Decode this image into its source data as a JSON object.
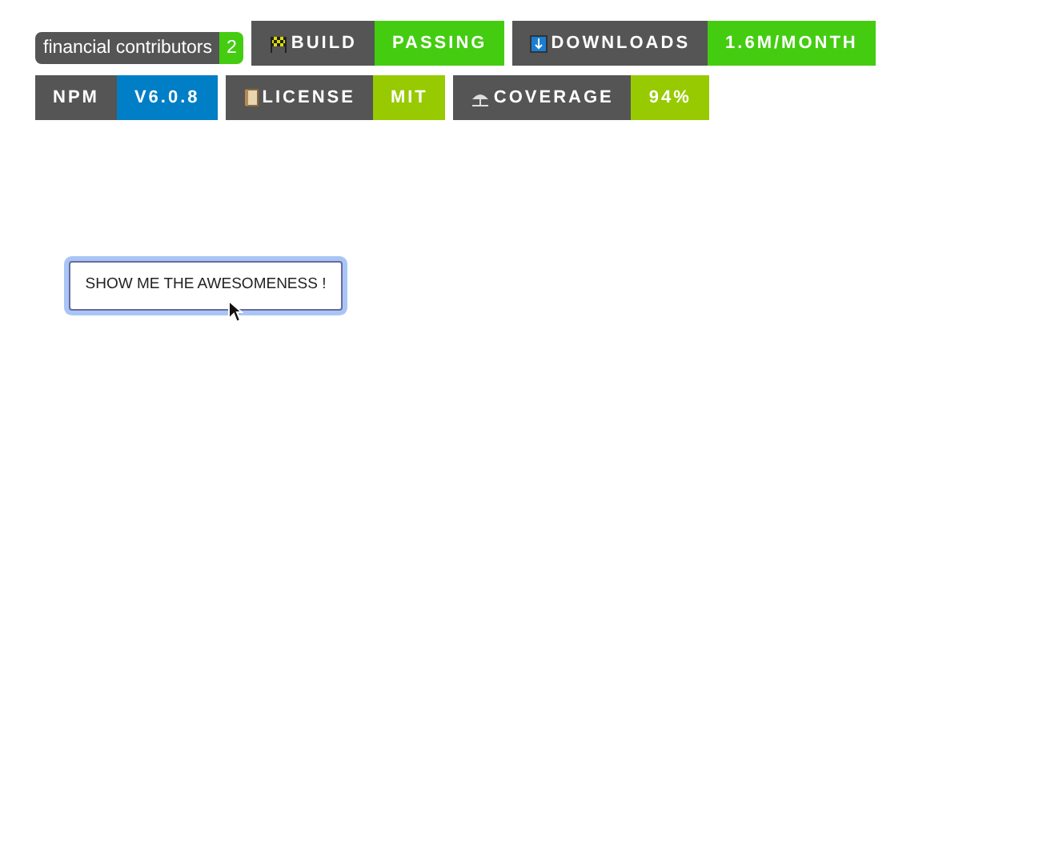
{
  "badges": [
    {
      "kind": "rounded",
      "label": "financial contributors",
      "value": "2",
      "color": "#4c1"
    },
    {
      "kind": "square",
      "label": "BUILD",
      "value": "PASSING",
      "color": "#44cc11"
    },
    {
      "kind": "square",
      "label": "DOWNLOADS",
      "value": "1.6M/MONTH",
      "color": "#44cc11"
    },
    {
      "kind": "square",
      "label": "NPM",
      "value": "V6.0.8",
      "color": "#007ec6"
    },
    {
      "kind": "square",
      "label": "LICENSE",
      "value": "MIT",
      "color": "#97ca00"
    },
    {
      "kind": "square",
      "label": "COVERAGE",
      "value": "94%",
      "color": "#97ca00"
    }
  ],
  "button": {
    "label": "SHOW ME THE AWESOMENESS !",
    "focused": true
  }
}
